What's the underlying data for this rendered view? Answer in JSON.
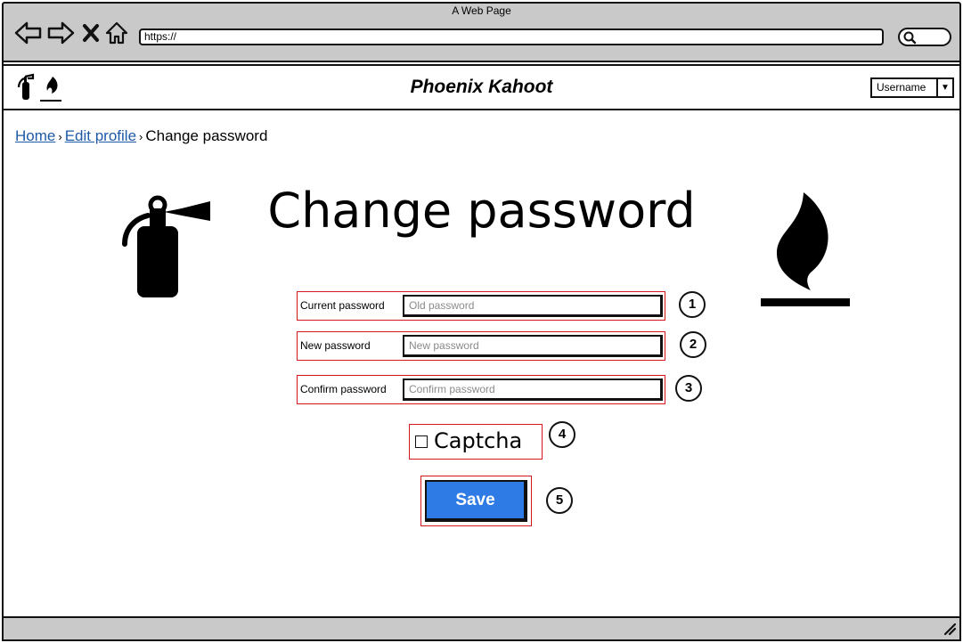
{
  "window": {
    "title": "A Web Page"
  },
  "browser": {
    "url": "https://"
  },
  "header": {
    "brand": "Phoenix Kahoot",
    "user_select": "Username"
  },
  "breadcrumb": {
    "home": "Home",
    "edit_profile": "Edit profile",
    "current": "Change password",
    "separator": "›"
  },
  "page": {
    "heading": "Change password"
  },
  "form": {
    "current": {
      "label": "Current password",
      "placeholder": "Old password",
      "badge": "1"
    },
    "new": {
      "label": "New password",
      "placeholder": "New password",
      "badge": "2"
    },
    "confirm": {
      "label": "Confirm password",
      "placeholder": "Confirm password",
      "badge": "3"
    },
    "captcha": {
      "label": "Captcha",
      "badge": "4"
    },
    "save": {
      "label": "Save",
      "badge": "5"
    }
  },
  "colors": {
    "accent": "#2f7be6",
    "annotation": "#d3171d",
    "link": "#1f5aa8",
    "chrome": "#c9c9c9"
  },
  "icons": [
    "back-arrow-icon",
    "forward-arrow-icon",
    "close-icon",
    "home-icon",
    "search-icon",
    "fire-extinguisher-icon",
    "flame-icon",
    "resize-grip-icon"
  ]
}
